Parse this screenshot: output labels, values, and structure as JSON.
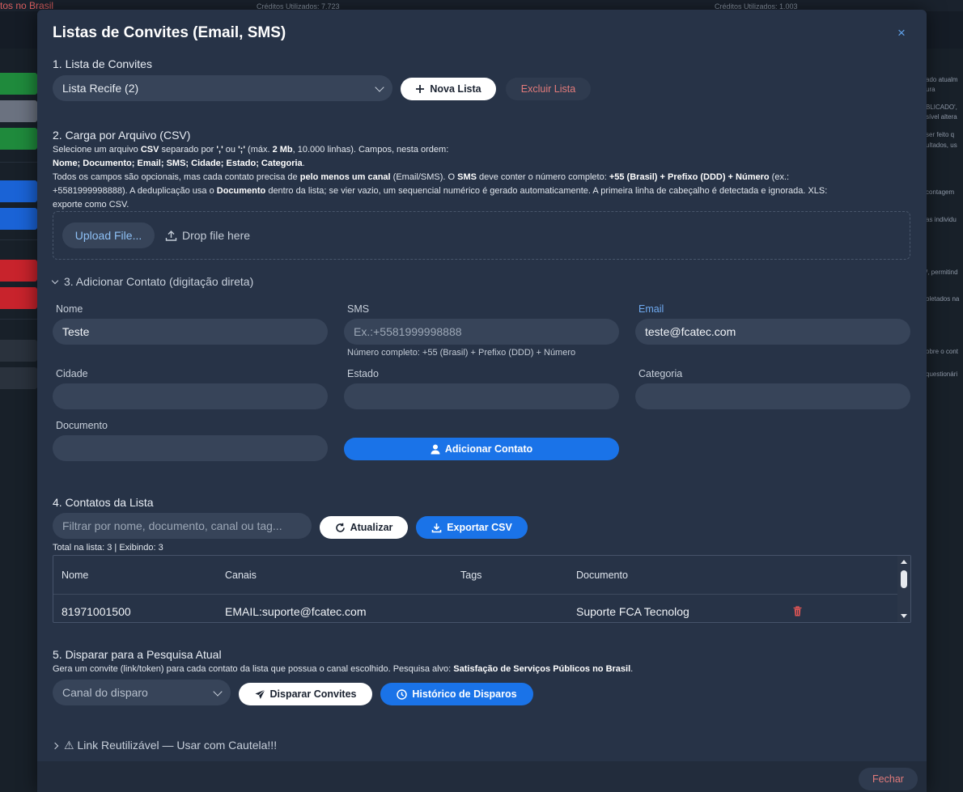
{
  "background": {
    "left_title": "tos no Brasil",
    "credits_1": "Créditos Utilizados: 7.723",
    "credits_2": "Créditos Utilizados: 1.003",
    "right_snippets": [
      "ado atualm",
      "ura",
      "BLICADO',",
      "sível altera",
      "ser feito q",
      "ultados, us",
      "contagem",
      "as individu",
      "/, permitind",
      "oletados na",
      "obre o cont",
      "questionári"
    ],
    "bar_colors": [
      "#1f8a3c",
      "#6b7280",
      "#1f8a3c",
      "#1a63d6",
      "#1a63d6",
      "#c8232c",
      "#c8232c",
      "#2a323d",
      "#2a323d"
    ]
  },
  "modal": {
    "title": "Listas de Convites (Email, SMS)",
    "close_label": "×",
    "section1": {
      "heading": "1. Lista de Convites",
      "selected_list": "Lista Recife (2)",
      "new_list_label": "Nova Lista",
      "delete_list_label": "Excluir Lista"
    },
    "section2": {
      "heading": "2. Carga por Arquivo (CSV)",
      "line1_a": "Selecione um arquivo ",
      "line1_b": "CSV",
      "line1_c": " separado por ",
      "line1_d": "','",
      "line1_e": " ou ",
      "line1_f": "';'",
      "line1_g": " (máx. ",
      "line1_h": "2 Mb",
      "line1_i": ", 10.000 linhas). Campos, nesta ordem:",
      "line2": "Nome; Documento; Email; SMS; Cidade; Estado; Categoria",
      "line3_a": "Todos os campos são opcionais, mas cada contato precisa de ",
      "line3_b": "pelo menos um canal",
      "line3_c": " (Email/SMS). O ",
      "line3_d": "SMS",
      "line3_e": " deve conter o número completo: ",
      "line3_f": "+55 (Brasil) + Prefixo (DDD) + Número",
      "line3_g": " (ex.:",
      "line4_a": "+5581999998888). A deduplicação usa o ",
      "line4_b": "Documento",
      "line4_c": " dentro da lista; se vier vazio, um sequencial numérico é gerado automaticamente. A primeira linha de cabeçalho é detectada e ignorada. XLS:",
      "line5": "exporte como CSV.",
      "upload_label": "Upload File...",
      "drop_label": "Drop file here"
    },
    "section3": {
      "heading": "3. Adicionar Contato (digitação direta)",
      "nome_label": "Nome",
      "nome_value": "Teste",
      "sms_label": "SMS",
      "sms_placeholder": "Ex.:+5581999998888",
      "sms_hint": "Número completo: +55 (Brasil) + Prefixo (DDD) + Número",
      "email_label": "Email",
      "email_value": "teste@fcatec.com",
      "cidade_label": "Cidade",
      "estado_label": "Estado",
      "categoria_label": "Categoria",
      "documento_label": "Documento",
      "add_label": "Adicionar Contato"
    },
    "section4": {
      "heading": "4. Contatos da Lista",
      "filter_placeholder": "Filtrar por nome, documento, canal ou tag...",
      "refresh_label": "Atualizar",
      "export_label": "Exportar CSV",
      "totals": "Total na lista: 3 | Exibindo: 3",
      "columns": [
        "Nome",
        "Canais",
        "Tags",
        "Documento"
      ],
      "rows": [
        {
          "nome": "81971001500",
          "canais": "EMAIL:suporte@fcatec.com",
          "tags": "",
          "documento": "Suporte FCA Tecnolog"
        }
      ]
    },
    "section5": {
      "heading": "5. Disparar para a Pesquisa Atual",
      "desc_a": "Gera um convite (link/token) para cada contato da lista que possua o canal escolhido. Pesquisa alvo: ",
      "desc_b": "Satisfação de Serviços Públicos no Brasil",
      "desc_c": ".",
      "channel_placeholder": "Canal do disparo",
      "send_label": "Disparar Convites",
      "history_label": "Histórico de Disparos"
    },
    "section6": {
      "heading": "⚠ Link Reutilizável — Usar com Cautela!!!"
    },
    "footer": {
      "close_label": "Fechar"
    }
  }
}
